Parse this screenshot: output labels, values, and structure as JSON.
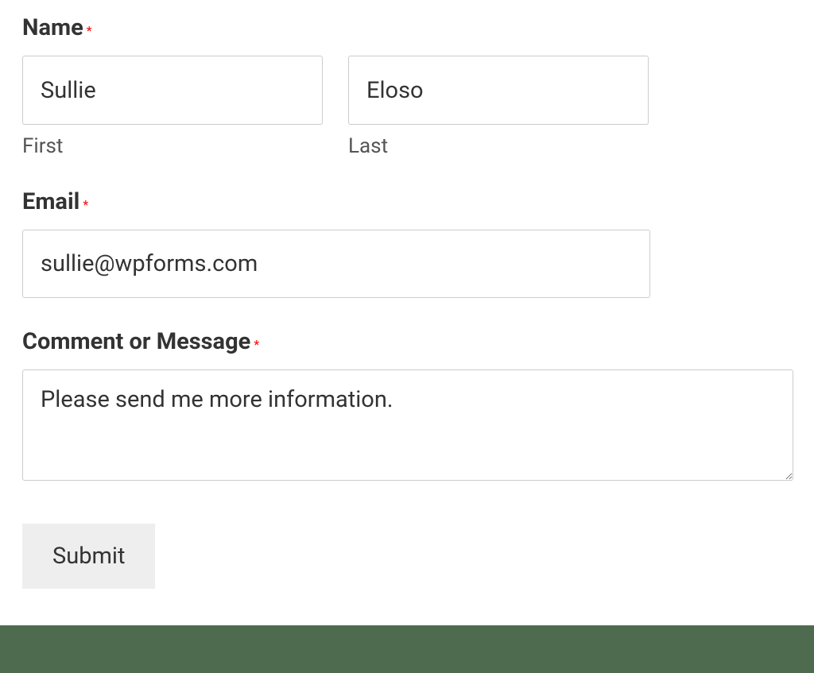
{
  "form": {
    "name": {
      "label": "Name",
      "required_marker": "*",
      "first": {
        "value": "Sullie",
        "sublabel": "First"
      },
      "last": {
        "value": "Eloso",
        "sublabel": "Last"
      }
    },
    "email": {
      "label": "Email",
      "required_marker": "*",
      "value": "sullie@wpforms.com"
    },
    "message": {
      "label": "Comment or Message",
      "required_marker": "*",
      "value": "Please send me more information."
    },
    "submit": {
      "label": "Submit"
    }
  },
  "colors": {
    "required": "#ff0000",
    "footer": "#4f6b4f",
    "border": "#cccccc",
    "text": "#333333"
  }
}
